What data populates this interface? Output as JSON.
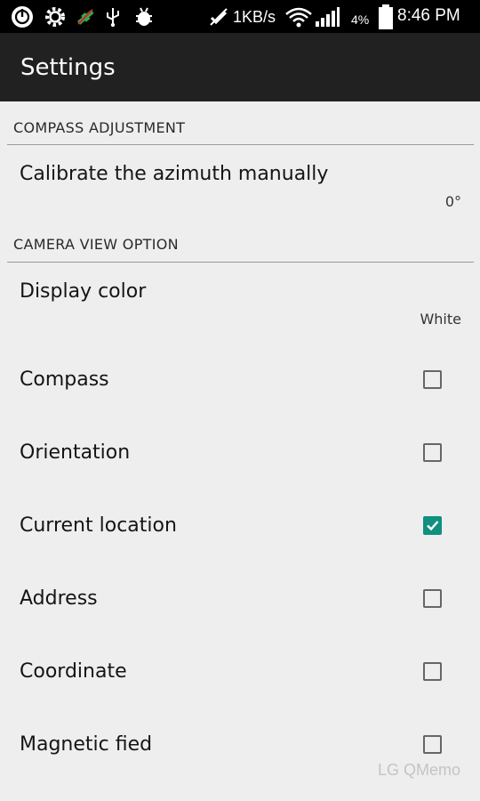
{
  "status_bar": {
    "speed": "1KB/s",
    "battery": "4%",
    "time": "8:46 PM",
    "icons": [
      "power-icon",
      "gear-icon",
      "satellite-icon",
      "usb-icon",
      "bug-icon",
      "no-sync-icon",
      "wifi-icon",
      "signal-icon",
      "battery-icon"
    ]
  },
  "app_bar": {
    "title": "Settings"
  },
  "sections": {
    "compass": {
      "header": "COMPASS ADJUSTMENT",
      "calibrate": {
        "title": "Calibrate the azimuth manually",
        "summary": "0°"
      }
    },
    "camera": {
      "header": "CAMERA VIEW OPTION",
      "display_color": {
        "title": "Display color",
        "summary": "White"
      },
      "options": [
        {
          "title": "Compass",
          "checked": false
        },
        {
          "title": "Orientation",
          "checked": false
        },
        {
          "title": "Current location",
          "checked": true
        },
        {
          "title": "Address",
          "checked": false
        },
        {
          "title": "Coordinate",
          "checked": false
        },
        {
          "title": "Magnetic fied",
          "checked": false
        }
      ]
    }
  },
  "colors": {
    "accent": "#10907f",
    "app_bar": "#212121",
    "background": "#eeeeee"
  },
  "watermark": "LG QMemo"
}
